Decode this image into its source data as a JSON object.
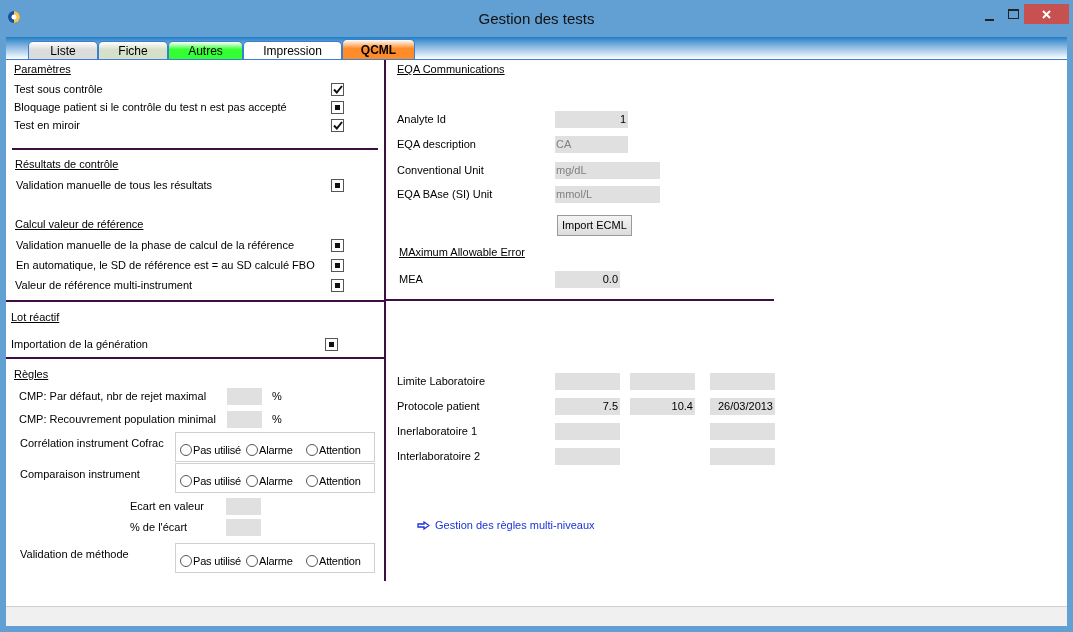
{
  "window": {
    "title": "Gestion des tests"
  },
  "tabs": [
    {
      "label": "Liste",
      "selected": false,
      "color": "#dcdcdc"
    },
    {
      "label": "Fiche",
      "selected": false,
      "color": "#d6e0c8"
    },
    {
      "label": "Autres",
      "selected": false,
      "color": "#33ff33"
    },
    {
      "label": "Impression",
      "selected": false,
      "color": "#ffffff"
    },
    {
      "label": "QCML",
      "selected": true,
      "color": "#ff8c2a"
    }
  ],
  "parametres": {
    "title": "Paramètres",
    "options": [
      {
        "label": "Test sous contrôle",
        "checked": true
      },
      {
        "label": "Bloquage patient si le contrôle du test n est pas  accepté",
        "checked": false,
        "indeterminate": true
      },
      {
        "label": "Test en miroir",
        "checked": true
      }
    ]
  },
  "resultats": {
    "title": "Résultats de contrôle",
    "options": [
      {
        "label": "Validation manuelle de tous les résultats",
        "checked": false,
        "indeterminate": true
      }
    ]
  },
  "calcul": {
    "title": "Calcul valeur de référence",
    "options": [
      {
        "label": "Validation manuelle de la  phase de calcul de la référence",
        "checked": false,
        "indeterminate": true
      },
      {
        "label": "En automatique, le SD de référence est = au SD calculé FBO",
        "checked": false,
        "indeterminate": true
      },
      {
        "label": "Valeur de référence multi-instrument",
        "checked": false,
        "indeterminate": true
      }
    ]
  },
  "lot": {
    "title": "Lot réactif",
    "options": [
      {
        "label": "Importation de la génération",
        "checked": false,
        "indeterminate": true
      }
    ]
  },
  "regles": {
    "title": "Règles ",
    "rows": [
      {
        "kind": "percent",
        "label": "CMP: Par défaut, nbr de rejet maximal",
        "unit": "%"
      },
      {
        "kind": "percent",
        "label": "CMP: Recouvrement population  minimal",
        "unit": "%"
      },
      {
        "kind": "radio",
        "label": "Corrélation instrument Cofrac",
        "options": [
          {
            "label": "Pas utilisé",
            "selected": false
          },
          {
            "label": "Alarme",
            "selected": false
          },
          {
            "label": "Attention",
            "selected": false
          }
        ]
      },
      {
        "kind": "radio",
        "label": "Comparaison instrument",
        "options": [
          {
            "label": "Pas utilisé",
            "selected": false
          },
          {
            "label": "Alarme",
            "selected": false
          },
          {
            "label": "Attention",
            "selected": false
          }
        ]
      },
      {
        "kind": "gap",
        "label": "Ecart en valeur"
      },
      {
        "kind": "gap",
        "label": "% de l'écart"
      },
      {
        "kind": "radio",
        "label": "Validation de méthode",
        "options": [
          {
            "label": "Pas utilisé",
            "selected": false
          },
          {
            "label": "Alarme",
            "selected": false
          },
          {
            "label": "Attention",
            "selected": false
          }
        ]
      }
    ]
  },
  "eqa": {
    "title": "EQA Communications",
    "fields": [
      {
        "label": "Analyte Id",
        "value": "1",
        "disabled": false
      },
      {
        "label": "EQA description",
        "value": "CA",
        "disabled": true
      },
      {
        "label": "Conventional  Unit",
        "value": "mg/dL",
        "disabled": true
      },
      {
        "label": "EQA BAse (SI) Unit",
        "value": "mmol/L",
        "disabled": true
      }
    ],
    "import_button": "Import ECML"
  },
  "mae": {
    "title": "MAximum Allowable Error",
    "fields": [
      {
        "label": "MEA",
        "value": "0.0"
      }
    ]
  },
  "limits": {
    "rows": [
      {
        "label": "Limite Laboratoire",
        "cells": [
          {},
          {},
          {}
        ]
      },
      {
        "label": "Protocole patient",
        "cells": [
          {
            "value": "7.5"
          },
          {
            "value": "10.4"
          },
          {
            "value": "26/03/2013"
          }
        ]
      },
      {
        "label": "Inerlaboratoire 1",
        "cells": [
          {},
          null,
          {}
        ]
      },
      {
        "label": "Interlaboratoire 2",
        "cells": [
          {},
          null,
          {}
        ]
      }
    ]
  },
  "link": "Gestion des règles multi-niveaux"
}
